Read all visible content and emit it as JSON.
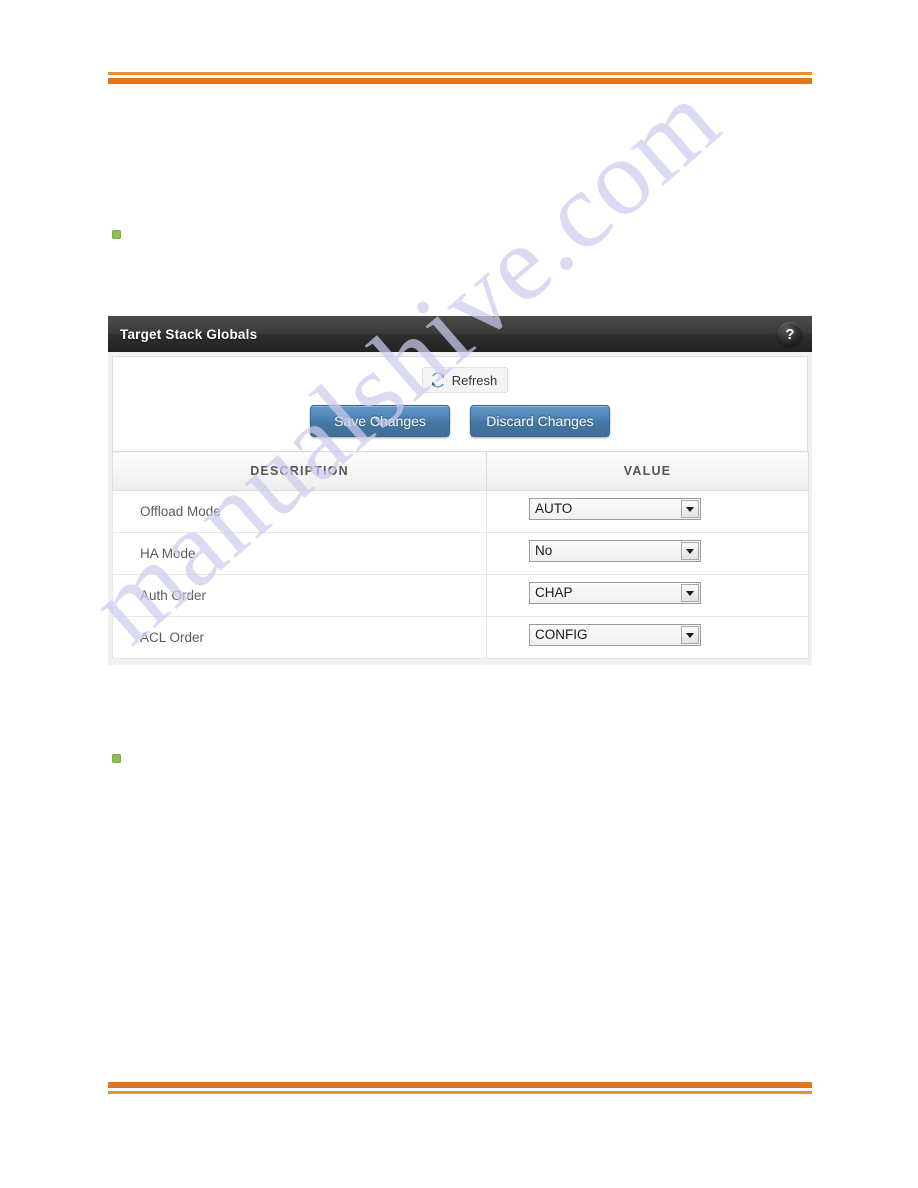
{
  "page": {
    "watermark_text": "manualshive.com",
    "accent_orange_thin": "#e8922c",
    "accent_orange_thick": "#e2751a",
    "bullet_color": "#8cc152"
  },
  "panel": {
    "title": "Target Stack Globals",
    "help_icon": "question-mark-icon",
    "help_label": "?"
  },
  "toolbar": {
    "refresh_icon": "refresh-icon",
    "refresh_label": "Refresh",
    "save_label": "Save Changes",
    "discard_label": "Discard Changes",
    "button_color": "#4a7fb3"
  },
  "table": {
    "columns": [
      "DESCRIPTION",
      "VALUE"
    ],
    "rows": [
      {
        "description": "Offload Mode",
        "value": "AUTO"
      },
      {
        "description": "HA Mode",
        "value": "No"
      },
      {
        "description": "Auth Order",
        "value": "CHAP"
      },
      {
        "description": "ACL Order",
        "value": "CONFIG"
      }
    ]
  }
}
